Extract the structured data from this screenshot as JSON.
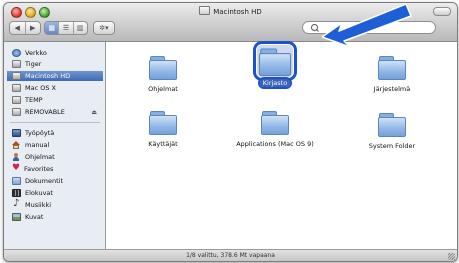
{
  "window": {
    "title": "Macintosh HD"
  },
  "toolbar": {
    "back_icon": "back-arrow-icon",
    "forward_icon": "forward-arrow-icon",
    "view_icons": [
      "icon-view-icon",
      "list-view-icon",
      "column-view-icon"
    ],
    "action_icon": "gear-icon",
    "search": {
      "value": "",
      "placeholder": ""
    }
  },
  "sidebar": {
    "devices": [
      {
        "label": "Verkko",
        "icon": "network-icon"
      },
      {
        "label": "Tiger",
        "icon": "disk-icon"
      },
      {
        "label": "Macintosh HD",
        "icon": "disk-icon",
        "selected": true
      },
      {
        "label": "Mac OS X",
        "icon": "disk-icon"
      },
      {
        "label": "TEMP",
        "icon": "disk-icon"
      },
      {
        "label": "REMOVABLE",
        "icon": "disk-icon",
        "eject": true
      }
    ],
    "places": [
      {
        "label": "Työpöytä",
        "icon": "desktop-icon"
      },
      {
        "label": "manual",
        "icon": "home-icon"
      },
      {
        "label": "Ohjelmat",
        "icon": "applications-icon"
      },
      {
        "label": "Favorites",
        "icon": "heart-icon"
      },
      {
        "label": "Dokumentit",
        "icon": "documents-icon"
      },
      {
        "label": "Elokuvat",
        "icon": "movies-icon"
      },
      {
        "label": "Musiikki",
        "icon": "music-icon"
      },
      {
        "label": "Kuvat",
        "icon": "pictures-icon"
      }
    ]
  },
  "content": {
    "items": [
      {
        "label": "Ohjelmat",
        "icon": "folder-icon"
      },
      {
        "label": "Kirjasto",
        "icon": "folder-icon",
        "selected": true
      },
      {
        "label": "Järjestelmä",
        "icon": "folder-icon"
      },
      {
        "label": "Käyttäjät",
        "icon": "folder-icon"
      },
      {
        "label": "Applications (Mac OS 9)",
        "icon": "folder-icon"
      },
      {
        "label": "System Folder",
        "icon": "folder-icon"
      }
    ]
  },
  "status": {
    "text": "1/8 valittu, 378.6 Mt vapaana"
  },
  "colors": {
    "selection": "#1f52c9",
    "arrow": "#1f5fd6",
    "sidebar_selected": "#4f78bd"
  }
}
